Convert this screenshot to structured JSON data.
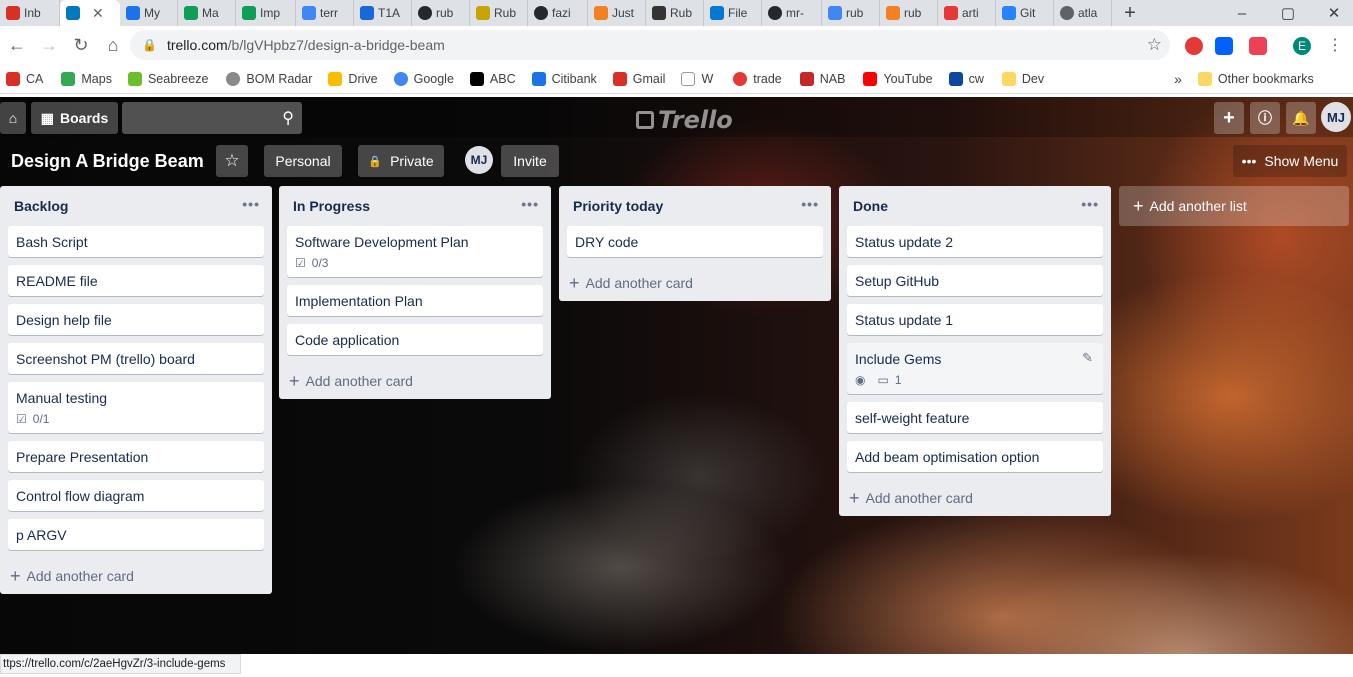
{
  "browser": {
    "tabs": [
      {
        "label": "Inb",
        "color": "#d93025"
      },
      {
        "label": "",
        "color": "#0079bf",
        "active": true
      },
      {
        "label": "My",
        "color": "#1a73e8"
      },
      {
        "label": "Ma",
        "color": "#0f9d58"
      },
      {
        "label": "Imp",
        "color": "#0f9d58"
      },
      {
        "label": "terr",
        "color": "#4285f4"
      },
      {
        "label": "T1A",
        "color": "#1868db"
      },
      {
        "label": "rub",
        "color": "#24292e"
      },
      {
        "label": "Rub",
        "color": "#c8a400"
      },
      {
        "label": "fazi",
        "color": "#24292e"
      },
      {
        "label": "Just",
        "color": "#f48024"
      },
      {
        "label": "Rub",
        "color": "#333333"
      },
      {
        "label": "File",
        "color": "#0078d4"
      },
      {
        "label": "mr-",
        "color": "#24292e"
      },
      {
        "label": "rub",
        "color": "#4285f4"
      },
      {
        "label": "rub",
        "color": "#f48024"
      },
      {
        "label": "arti",
        "color": "#e53935"
      },
      {
        "label": "Git",
        "color": "#2684ff"
      },
      {
        "label": "atla",
        "color": "#5f6368"
      }
    ],
    "active_tab_close": "✕",
    "url_host": "trello.com",
    "url_path": "/b/lgVHpbz7/design-a-bridge-beam",
    "bookmarks": [
      {
        "label": "CA",
        "color": "#d93025"
      },
      {
        "label": "Maps",
        "color": "#34a853"
      },
      {
        "label": "Seabreeze",
        "color": "#6abf2a"
      },
      {
        "label": "BOM Radar",
        "color": "#8a8a8a"
      },
      {
        "label": "Drive",
        "color": "#fbbc04"
      },
      {
        "label": "Google",
        "color": "#4285f4"
      },
      {
        "label": "ABC",
        "color": "#000000"
      },
      {
        "label": "Citibank",
        "color": "#1a73e8"
      },
      {
        "label": "Gmail",
        "color": "#d93025"
      },
      {
        "label": "W",
        "color": "#ffffff"
      },
      {
        "label": "trade",
        "color": "#e53935"
      },
      {
        "label": "NAB",
        "color": "#c62828"
      },
      {
        "label": "YouTube",
        "color": "#ff0000"
      },
      {
        "label": "cw",
        "color": "#0d47a1"
      },
      {
        "label": "Dev",
        "color": "#fdd663"
      }
    ],
    "bookmarks_overflow": "»",
    "other_bookmarks": "Other bookmarks",
    "status_url": "ttps://trello.com/c/2aeHgvZr/3-include-gems",
    "profile_initial": "E"
  },
  "trello": {
    "nav": {
      "boards_label": "Boards",
      "logo_text": "Trello",
      "user_initials": "MJ"
    },
    "board": {
      "title": "Design A Bridge Beam",
      "visibility_team": "Personal",
      "visibility": "Private",
      "member_initials": "MJ",
      "invite_label": "Invite",
      "show_menu_label": "Show Menu"
    },
    "add_card_label": "Add another card",
    "add_list_label": "Add another list",
    "lists": [
      {
        "title": "Backlog",
        "cards": [
          {
            "title": "Bash Script"
          },
          {
            "title": "README file"
          },
          {
            "title": "Design help file"
          },
          {
            "title": "Screenshot PM (trello) board"
          },
          {
            "title": "Manual testing",
            "checklist": "0/1"
          },
          {
            "title": "Prepare Presentation"
          },
          {
            "title": "Control flow diagram"
          },
          {
            "title": "p ARGV"
          }
        ]
      },
      {
        "title": "In Progress",
        "cards": [
          {
            "title": "Software Development Plan",
            "checklist": "0/3"
          },
          {
            "title": "Implementation Plan"
          },
          {
            "title": "Code application"
          }
        ]
      },
      {
        "title": "Priority today",
        "cards": [
          {
            "title": "DRY code"
          }
        ]
      },
      {
        "title": "Done",
        "cards": [
          {
            "title": "Status update 2"
          },
          {
            "title": "Setup GitHub"
          },
          {
            "title": "Status update 1"
          },
          {
            "title": "Include Gems",
            "comments": "1",
            "watching": true
          },
          {
            "title": "self-weight feature"
          },
          {
            "title": "Add beam optimisation option"
          }
        ]
      }
    ]
  }
}
